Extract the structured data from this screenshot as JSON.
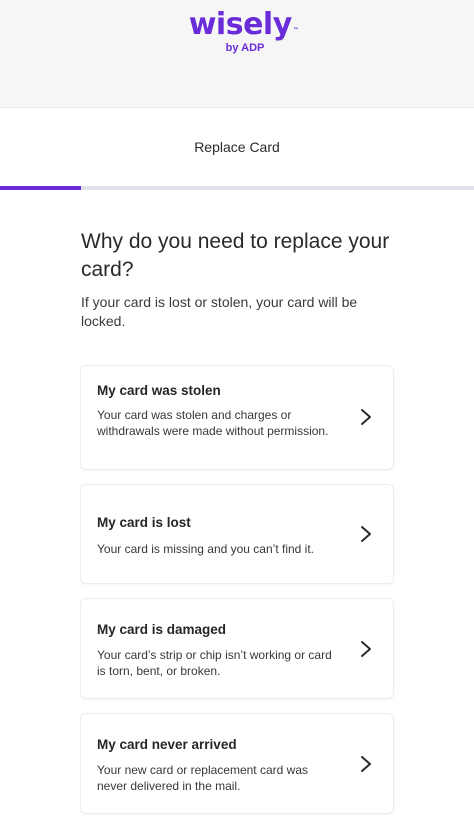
{
  "brand": {
    "logo_word": "wisely",
    "logo_tm": "™",
    "logo_sub": "by ADP",
    "color": "#6a2bd8"
  },
  "header": {
    "title": "Replace Card"
  },
  "progress": {
    "fraction": 0.17
  },
  "question": {
    "heading": "Why do you need to replace your card?",
    "subtext": "If your card is lost or stolen, your card will be locked."
  },
  "options": [
    {
      "title": "My card was stolen",
      "description": "Your card was stolen and charges or withdrawals were made without permission.",
      "icon": "chevron-right-icon"
    },
    {
      "title": "My card is lost",
      "description": "Your card is missing and you can’t find it.",
      "icon": "chevron-right-icon"
    },
    {
      "title": "My card is damaged",
      "description": "Your card’s strip or chip isn’t working or card is torn, bent, or broken.",
      "icon": "chevron-right-icon"
    },
    {
      "title": "My card never arrived",
      "description": "Your new card or replacement card was never delivered in the mail.",
      "icon": "chevron-right-icon"
    }
  ]
}
